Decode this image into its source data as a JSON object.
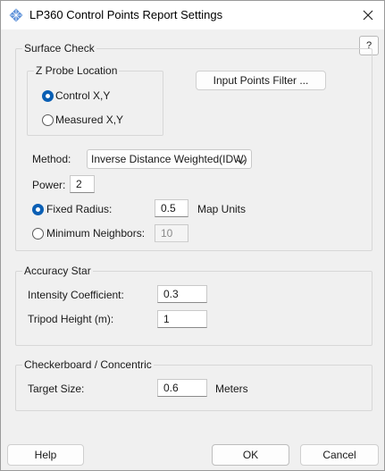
{
  "window": {
    "title": "LP360 Control Points Report Settings"
  },
  "help_button": "?",
  "surface_check": {
    "legend": "Surface Check",
    "z_probe": {
      "legend": "Z Probe Location",
      "options": [
        {
          "label": "Control X,Y",
          "checked": true
        },
        {
          "label": "Measured X,Y",
          "checked": false
        }
      ]
    },
    "input_points_filter": "Input Points Filter ...",
    "method": {
      "label": "Method:",
      "value": "Inverse Distance Weighted(IDW)"
    },
    "power": {
      "label": "Power:",
      "value": "2"
    },
    "fixed_radius": {
      "label": "Fixed Radius:",
      "value": "0.5",
      "unit": "Map Units",
      "checked": true
    },
    "min_neighbors": {
      "label": "Minimum Neighbors:",
      "value": "10",
      "checked": false
    }
  },
  "accuracy_star": {
    "legend": "Accuracy Star",
    "intensity_coefficient": {
      "label": "Intensity Coefficient:",
      "value": "0.3"
    },
    "tripod_height": {
      "label": "Tripod Height (m):",
      "value": "1"
    }
  },
  "checkerboard": {
    "legend": "Checkerboard / Concentric",
    "target_size": {
      "label": "Target Size:",
      "value": "0.6",
      "unit": "Meters"
    }
  },
  "footer": {
    "help": "Help",
    "ok": "OK",
    "cancel": "Cancel"
  },
  "colors": {
    "accent": "#0a5fb4",
    "background": "#f0f0f0"
  }
}
